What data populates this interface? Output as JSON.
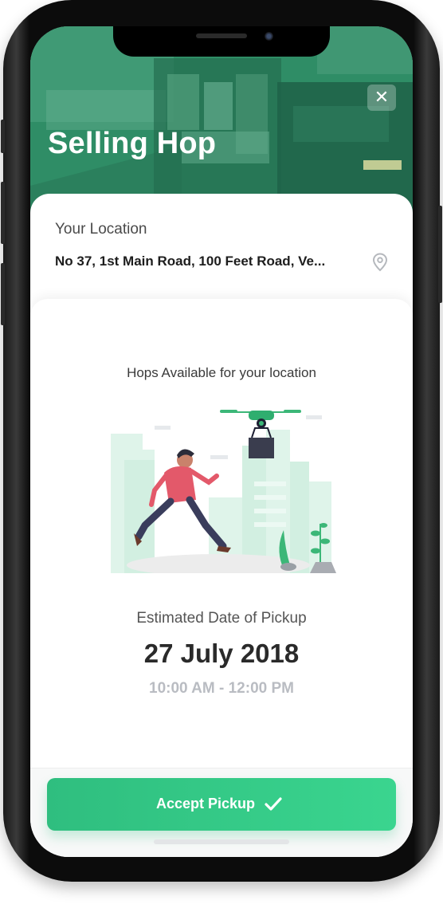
{
  "header": {
    "title": "Selling Hop",
    "close_icon": "close-icon"
  },
  "location": {
    "label": "Your Location",
    "value": "No 37, 1st Main Road, 100 Feet Road, Ve...",
    "icon": "location-pin-icon"
  },
  "availability": {
    "text": "Hops Available for your location",
    "illustration": "drone-delivery-illustration"
  },
  "pickup": {
    "label": "Estimated Date of Pickup",
    "date": "27 July 2018",
    "time": "10:00 AM - 12:00 PM"
  },
  "action": {
    "label": "Accept Pickup",
    "icon": "checkmark-icon"
  },
  "colors": {
    "accent": "#2fbe7f",
    "header_overlay": "#2b8a62"
  }
}
